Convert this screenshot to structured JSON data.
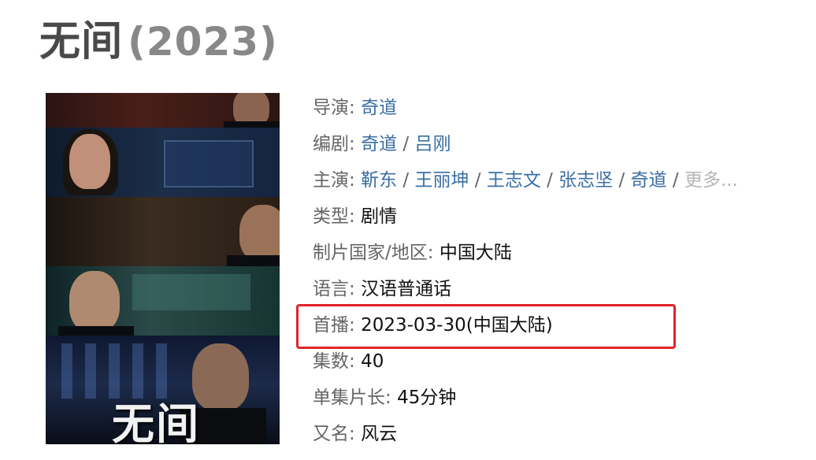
{
  "title": {
    "name": "无间",
    "year": "(2023)"
  },
  "poster": {
    "title_text": "无间"
  },
  "info": {
    "director": {
      "label": "导演",
      "values": [
        "奇道"
      ]
    },
    "writer": {
      "label": "编剧",
      "values": [
        "奇道",
        "吕刚"
      ]
    },
    "cast": {
      "label": "主演",
      "values": [
        "靳东",
        "王丽坤",
        "王志文",
        "张志坚",
        "奇道"
      ],
      "more": "更多..."
    },
    "genre": {
      "label": "类型",
      "value": "剧情"
    },
    "country": {
      "label": "制片国家/地区",
      "value": "中国大陆"
    },
    "language": {
      "label": "语言",
      "value": "汉语普通话"
    },
    "premiere": {
      "label": "首播",
      "value": "2023-03-30(中国大陆)"
    },
    "episodes": {
      "label": "集数",
      "value": "40"
    },
    "runtime": {
      "label": "单集片长",
      "value": "45分钟"
    },
    "aka": {
      "label": "又名",
      "value": "风云"
    }
  },
  "colors": {
    "link": "#3b6fa3",
    "label": "#666666",
    "highlight_border": "#e2232a",
    "title": "#494949"
  }
}
